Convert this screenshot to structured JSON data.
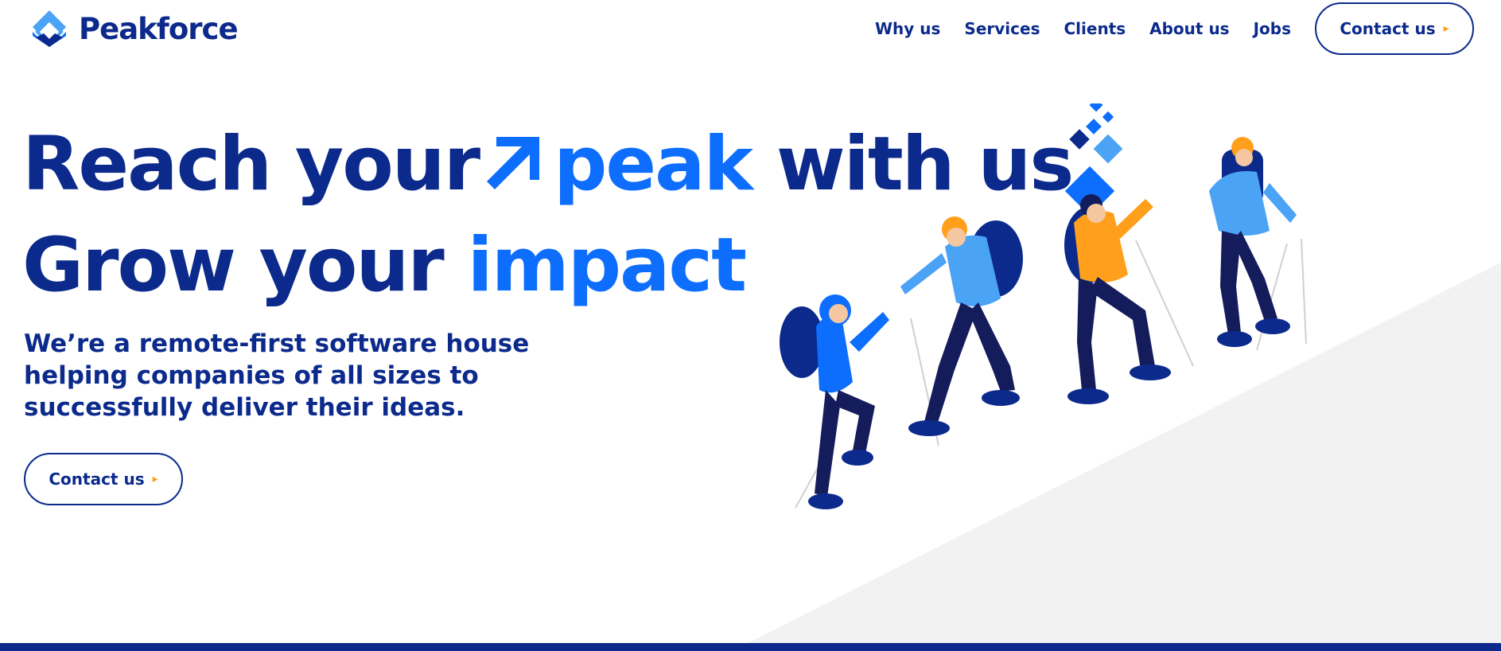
{
  "brand": {
    "name": "Peakforce",
    "logo_icon": "peakforce-logo-icon"
  },
  "nav": {
    "items": [
      "Why us",
      "Services",
      "Clients",
      "About us",
      "Jobs"
    ],
    "cta_label": "Contact us",
    "cta_icon": "chevron-right-icon"
  },
  "hero": {
    "line1_part1": "Reach your",
    "arrow_icon": "arrow-up-right-icon",
    "line1_accent": "peak",
    "line1_part2": "with us.",
    "line2_part1": "Grow your",
    "line2_accent": "impact",
    "subtitle": "We’re a remote-first software house helping companies of all sizes to successfully deliver their ideas.",
    "cta_label": "Contact us",
    "illustration": "hikers-climbing-illustration"
  },
  "colors": {
    "primary": "#0b2a8c",
    "accent": "#0d6efd",
    "orange": "#ff9f1c",
    "light_blue": "#4ba3f5",
    "slope": "#f2f2f2"
  }
}
